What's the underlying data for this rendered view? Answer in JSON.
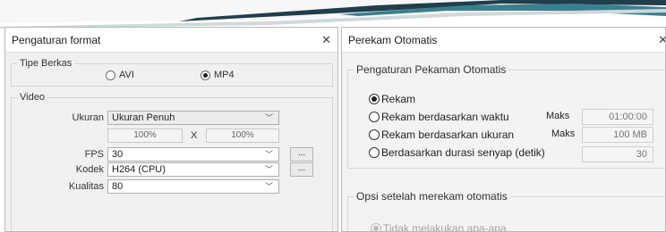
{
  "left_window": {
    "title": "Pengaturan format",
    "file_type": {
      "legend": "Tipe Berkas",
      "options": [
        {
          "label": "AVI",
          "selected": false
        },
        {
          "label": "MP4",
          "selected": true
        }
      ]
    },
    "video": {
      "legend": "Video",
      "size_label": "Ukuran",
      "size_value": "Ukuran Penuh",
      "width_pct": "100%",
      "times": "X",
      "height_pct": "100%",
      "fps_label": "FPS",
      "fps_value": "30",
      "codec_label": "Kodek",
      "codec_value": "H264 (CPU)",
      "quality_label": "Kualitas",
      "quality_value": "80",
      "more_button": "..."
    }
  },
  "right_window": {
    "title": "Perekam Otomatis",
    "settings_group": {
      "legend": "Pengaturan Pekaman Otomatis",
      "options": [
        {
          "label": "Rekam",
          "selected": true
        },
        {
          "label": "Rekam berdasarkan waktu",
          "selected": false
        },
        {
          "label": "Rekam berdasarkan ukuran",
          "selected": false
        },
        {
          "label": "Berdasarkan durasi senyap (detik)",
          "selected": false
        }
      ],
      "max_label": "Maks",
      "max_time": "01:00:00",
      "max_size": "100 MB",
      "silence_seconds": "30"
    },
    "after_group": {
      "legend": "Opsi setelah merekam otomatis",
      "option": "Tidak melakukan apa-apa",
      "option_selected": true
    }
  },
  "icons": {
    "close": "close-icon",
    "dropdown": "chevron-down-icon"
  },
  "colors": {
    "banner_dark": "#173545",
    "banner_teal": "#3f8290",
    "window_bg": "#f0f0f0"
  }
}
